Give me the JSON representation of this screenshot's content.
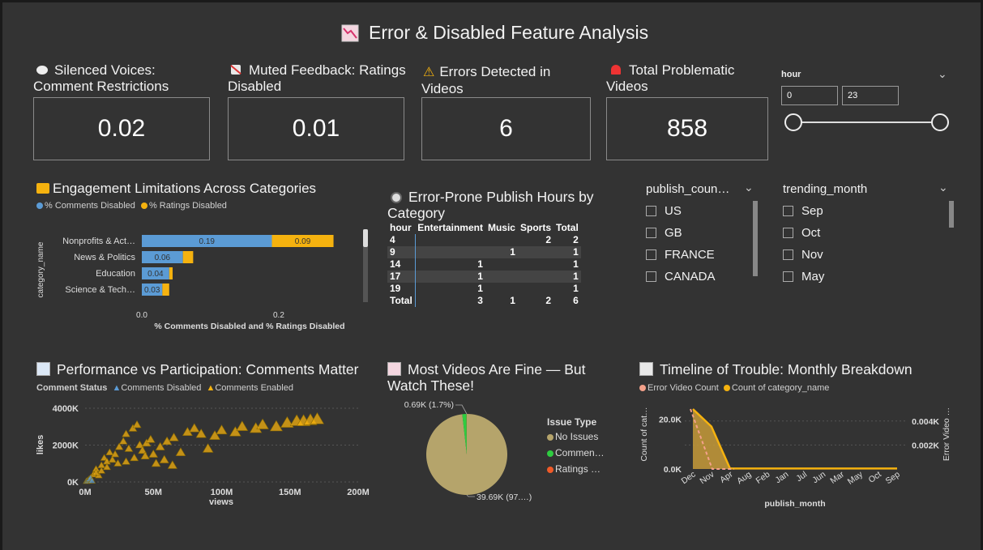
{
  "page": {
    "title": "Error & Disabled Feature Analysis",
    "title_icon": "chart-down-icon"
  },
  "cards": [
    {
      "icon": "speech-bubble-icon",
      "label": "Silenced Voices: Comment Restrictions",
      "value": "0.02"
    },
    {
      "icon": "muted-speaker-icon",
      "label": "Muted Feedback: Ratings Disabled",
      "value": "0.01"
    },
    {
      "icon": "warning-icon",
      "label": "Errors Detected in Videos",
      "value": "6"
    },
    {
      "icon": "siren-icon",
      "label": "Total Problematic Videos",
      "value": "858"
    }
  ],
  "hour_slicer": {
    "title": "hour",
    "min": "0",
    "max": "23",
    "range": [
      0,
      23
    ]
  },
  "engagement": {
    "title": "Engagement Limitations Across Categories",
    "icon": "folder-icon",
    "legend": [
      "% Comments Disabled",
      "% Ratings Disabled"
    ],
    "xlabel": "% Comments Disabled and % Ratings Disabled",
    "ylabel": "category_name",
    "ticks": [
      "0.0",
      "0.2"
    ]
  },
  "matrix": {
    "title": "Error-Prone Publish Hours by Category",
    "icon": "clock-icon",
    "headers": [
      "hour",
      "Entertainment",
      "Music",
      "Sports",
      "Total"
    ],
    "rows": [
      [
        "4",
        "",
        "",
        "2",
        "2"
      ],
      [
        "9",
        "",
        "1",
        "",
        "1"
      ],
      [
        "14",
        "1",
        "",
        "",
        "1"
      ],
      [
        "17",
        "1",
        "",
        "",
        "1"
      ],
      [
        "19",
        "1",
        "",
        "",
        "1"
      ],
      [
        "Total",
        "3",
        "1",
        "2",
        "6"
      ]
    ]
  },
  "country_slicer": {
    "title": "publish_coun…",
    "options": [
      "US",
      "GB",
      "FRANCE",
      "CANADA"
    ]
  },
  "month_slicer": {
    "title": "trending_month",
    "options": [
      "Sep",
      "Oct",
      "Nov",
      "May"
    ]
  },
  "scatter": {
    "title": "Performance vs Participation: Comments Matter",
    "icon": "chart-up-icon",
    "legend_title": "Comment Status",
    "legend": [
      "Comments Disabled",
      "Comments Enabled"
    ],
    "xlabel": "views",
    "ylabel": "likes",
    "xticks": [
      "0M",
      "50M",
      "100M",
      "150M",
      "200M"
    ],
    "yticks": [
      "0K",
      "2000K",
      "4000K"
    ]
  },
  "pie": {
    "title": "Most Videos Are Fine — But Watch These!",
    "icon": "chart-down-icon",
    "legend_title": "Issue Type",
    "legend": [
      "No Issues",
      "Commen…",
      "Ratings …"
    ],
    "label_small": "0.69K (1.7%)",
    "label_big": "39.69K (97.…)"
  },
  "timeline": {
    "title": "Timeline of Trouble: Monthly Breakdown",
    "icon": "bar-chart-icon",
    "legend": [
      "Error Video Count",
      "Count of category_name"
    ],
    "xlabel": "publish_month",
    "ylabel_left": "Count of cat…",
    "ylabel_right": "Error Video …",
    "yticks_left": [
      "0.0K",
      "20.0K"
    ],
    "yticks_right": [
      "0.002K",
      "0.004K"
    ]
  },
  "chart_data": [
    {
      "type": "bar",
      "stacked": true,
      "orientation": "horizontal",
      "title": "Engagement Limitations Across Categories",
      "xlabel": "% Comments Disabled and % Ratings Disabled",
      "ylabel": "category_name",
      "categories": [
        "Nonprofits & Act…",
        "News & Politics",
        "Education",
        "Science & Tech…"
      ],
      "series": [
        {
          "name": "% Comments Disabled",
          "color": "#5b9bd5",
          "values": [
            0.19,
            0.06,
            0.04,
            0.03
          ],
          "labels": [
            "0.19",
            "0.06",
            "0.04",
            "0.03"
          ]
        },
        {
          "name": "% Ratings Disabled",
          "color": "#f5b20f",
          "values": [
            0.09,
            0.015,
            0.005,
            0.01
          ],
          "labels": [
            "0.09",
            "",
            "",
            ""
          ]
        }
      ],
      "xlim": [
        0,
        0.29
      ]
    },
    {
      "type": "scatter",
      "title": "Performance vs Participation: Comments Matter",
      "xlabel": "views",
      "ylabel": "likes",
      "xlim": [
        0,
        200
      ],
      "ylim": [
        0,
        4000
      ],
      "x_unit": "M",
      "y_unit": "K",
      "series": [
        {
          "name": "Comments Disabled",
          "color": "#5b9bd5",
          "points": [
            [
              1,
              40
            ],
            [
              2,
              90
            ],
            [
              3,
              150
            ],
            [
              4,
              220
            ],
            [
              5,
              60
            ]
          ]
        },
        {
          "name": "Comments Enabled",
          "color": "#f5b20f",
          "points": [
            [
              2,
              50
            ],
            [
              4,
              200
            ],
            [
              6,
              400
            ],
            [
              8,
              700
            ],
            [
              10,
              350
            ],
            [
              12,
              900
            ],
            [
              14,
              1300
            ],
            [
              16,
              1100
            ],
            [
              18,
              1600
            ],
            [
              20,
              1200
            ],
            [
              22,
              1500
            ],
            [
              25,
              1900
            ],
            [
              28,
              2200
            ],
            [
              30,
              2600
            ],
            [
              32,
              1800
            ],
            [
              35,
              2900
            ],
            [
              38,
              3100
            ],
            [
              40,
              2000
            ],
            [
              42,
              1700
            ],
            [
              45,
              2100
            ],
            [
              48,
              2300
            ],
            [
              50,
              1500
            ],
            [
              55,
              1900
            ],
            [
              60,
              2200
            ],
            [
              65,
              2400
            ],
            [
              70,
              1600
            ],
            [
              75,
              2700
            ],
            [
              80,
              2900
            ],
            [
              85,
              2600
            ],
            [
              90,
              1800
            ],
            [
              95,
              2500
            ],
            [
              100,
              2800
            ],
            [
              110,
              2700
            ],
            [
              115,
              3000
            ],
            [
              125,
              2900
            ],
            [
              130,
              3100
            ],
            [
              140,
              3000
            ],
            [
              148,
              3200
            ],
            [
              155,
              3300
            ],
            [
              160,
              3300
            ],
            [
              165,
              3350
            ],
            [
              170,
              3400
            ],
            [
              8,
              500
            ],
            [
              12,
              600
            ],
            [
              16,
              800
            ],
            [
              24,
              1000
            ],
            [
              30,
              1100
            ],
            [
              36,
              1300
            ],
            [
              44,
              1400
            ],
            [
              52,
              1000
            ],
            [
              58,
              1200
            ],
            [
              64,
              900
            ]
          ]
        }
      ]
    },
    {
      "type": "pie",
      "title": "Most Videos Are Fine — But Watch These!",
      "slices": [
        {
          "label": "No Issues",
          "value": 39.69,
          "color": "#b5a46b"
        },
        {
          "label": "Commen…",
          "value": 0.69,
          "color": "#2ecc40"
        },
        {
          "label": "Ratings …",
          "value": 0.03,
          "color": "#f05a28"
        }
      ]
    },
    {
      "type": "area",
      "title": "Timeline of Trouble: Monthly Breakdown",
      "xlabel": "publish_month",
      "categories": [
        "Dec",
        "Nov",
        "Apr",
        "Aug",
        "Feb",
        "Jan",
        "Jul",
        "Jun",
        "Mar",
        "May",
        "Oct",
        "Sep"
      ],
      "series": [
        {
          "name": "Count of category_name",
          "color": "#f5b20f",
          "values": [
            24,
            17,
            0.2,
            0.2,
            0.2,
            0.2,
            0.2,
            0.2,
            0.2,
            0.2,
            0.2,
            0.2
          ],
          "unit": "K"
        },
        {
          "name": "Error Video Count",
          "color": "#f4a18a",
          "values": [
            0.005,
            0.0,
            0,
            0,
            0,
            0,
            0,
            0,
            0,
            0,
            0,
            0
          ],
          "unit": "K"
        }
      ],
      "ylim_left": [
        0,
        24
      ],
      "ylim_right": [
        0,
        0.005
      ]
    }
  ]
}
